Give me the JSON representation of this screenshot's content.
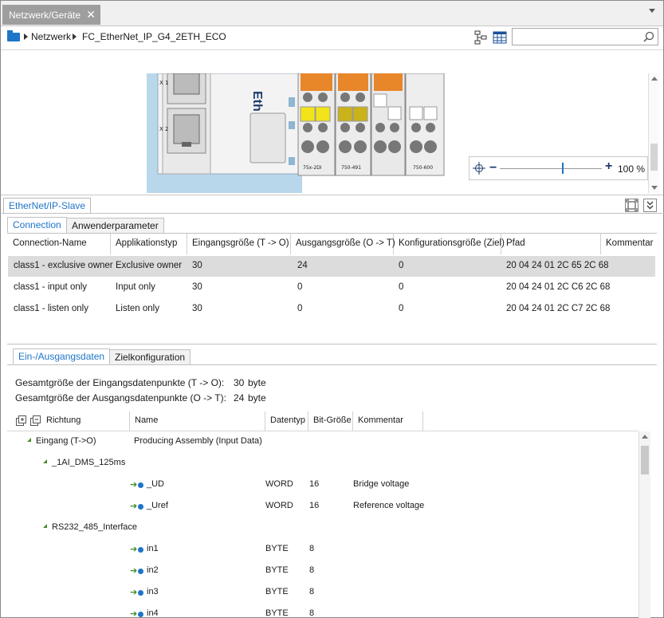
{
  "window": {
    "tab_title": "Netzwerk/Geräte",
    "tab_close": "✕"
  },
  "breadcrumb": {
    "items": [
      "Netzwerk",
      "FC_EtherNet_IP_G4_2ETH_ECO"
    ]
  },
  "search": {
    "placeholder": "",
    "value": ""
  },
  "device_image": {
    "label_ethernet": "Eth",
    "port_labels": [
      "X 1",
      "X 2"
    ],
    "module_labels": [
      "75x-2DI",
      "750-491",
      "750-600"
    ]
  },
  "zoom": {
    "level": "100 %",
    "minus": "−",
    "plus": "+",
    "fraction": 0.61
  },
  "panel": {
    "title": "EtherNet/IP-Slave",
    "tabs": [
      "Connection",
      "Anwenderparameter"
    ],
    "active_tab": 0,
    "connections": {
      "columns": [
        "Connection-Name",
        "Applikationstyp",
        "Eingangsgröße (T -> O)",
        "Ausgangsgröße (O -> T)",
        "Konfigurationsgröße (Ziel)",
        "Pfad",
        "Kommentar"
      ],
      "rows": [
        [
          "class1 - exclusive owner",
          "Exclusive owner",
          "30",
          "24",
          "0",
          "20 04 24 01 2C 65 2C 68",
          ""
        ],
        [
          "class1 - input only",
          "Input only",
          "30",
          "0",
          "0",
          "20 04 24 01 2C C6 2C 68",
          ""
        ],
        [
          "class1 - listen only",
          "Listen only",
          "30",
          "0",
          "0",
          "20 04 24 01 2C C7 2C 68",
          ""
        ]
      ],
      "selected_row": 0
    },
    "io_tabs": [
      "Ein-/Ausgangsdaten",
      "Zielkonfiguration"
    ],
    "io_active_tab": 0,
    "io_summary": {
      "input_label": "Gesamtgröße der Eingangsdatenpunkte (T -> O):",
      "input_value": "30",
      "input_unit": "byte",
      "output_label": "Gesamtgröße der Ausgangsdatenpunkte (O -> T):",
      "output_value": "24",
      "output_unit": "byte"
    },
    "io_columns": [
      "Richtung",
      "Name",
      "Datentyp",
      "Bit-Größe",
      "Kommentar"
    ],
    "io_tree": [
      {
        "level": 0,
        "expander": true,
        "richtung": "Eingang (T->O)",
        "name": "Producing Assembly (Input Data)",
        "type": "",
        "bits": "",
        "comment": ""
      },
      {
        "level": 1,
        "expander": true,
        "richtung": "_1AI_DMS_125ms",
        "name": "",
        "type": "",
        "bits": "",
        "comment": ""
      },
      {
        "level": 2,
        "expander": false,
        "richtung": "_UD",
        "name": "",
        "type": "WORD",
        "bits": "16",
        "comment": "Bridge voltage"
      },
      {
        "level": 2,
        "expander": false,
        "richtung": "_Uref",
        "name": "",
        "type": "WORD",
        "bits": "16",
        "comment": "Reference voltage"
      },
      {
        "level": 1,
        "expander": true,
        "richtung": "RS232_485_Interface",
        "name": "",
        "type": "",
        "bits": "",
        "comment": ""
      },
      {
        "level": 2,
        "expander": false,
        "richtung": "in1",
        "name": "",
        "type": "BYTE",
        "bits": "8",
        "comment": ""
      },
      {
        "level": 2,
        "expander": false,
        "richtung": "in2",
        "name": "",
        "type": "BYTE",
        "bits": "8",
        "comment": ""
      },
      {
        "level": 2,
        "expander": false,
        "richtung": "in3",
        "name": "",
        "type": "BYTE",
        "bits": "8",
        "comment": ""
      },
      {
        "level": 2,
        "expander": false,
        "richtung": "in4",
        "name": "",
        "type": "BYTE",
        "bits": "8",
        "comment": ""
      }
    ]
  },
  "colors": {
    "accent": "#1e74c8",
    "tab_bg": "#9e9e9e",
    "selection": "#dcdcdc",
    "device_blue": "#b9d7ea",
    "io_yellow": "#f2e31a",
    "io_orange": "#e8862a"
  }
}
